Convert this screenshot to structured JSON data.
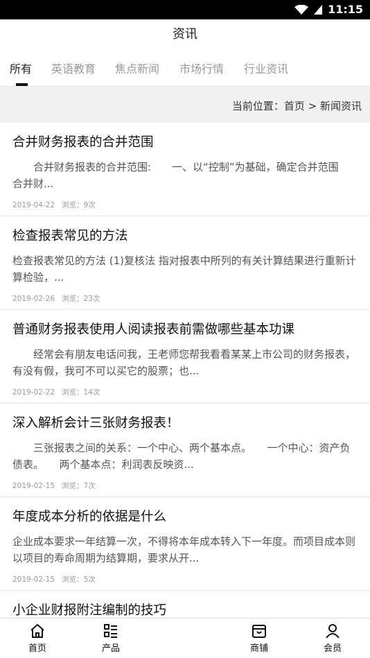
{
  "status": {
    "time": "11:15"
  },
  "header": {
    "title": "资讯"
  },
  "tabs": [
    {
      "label": "所有"
    },
    {
      "label": "英语教育"
    },
    {
      "label": "焦点新闻"
    },
    {
      "label": "市场行情"
    },
    {
      "label": "行业资讯"
    }
  ],
  "breadcrumb": {
    "text": "当前位置：首页 > 新闻资讯"
  },
  "articles": [
    {
      "title": "合并财务报表的合并范围",
      "summary": "　　合并财务报表的合并范围:　　一、以“控制”为基础，确定合并范围　　合并财...",
      "date": "2019-04-22",
      "views": "浏览：9次"
    },
    {
      "title": "检查报表常见的方法",
      "summary": "检查报表常见的方法 (1)复核法 指对报表中所列的有关计算结果进行重新计算检验，...",
      "date": "2019-02-26",
      "views": "浏览：23次"
    },
    {
      "title": "普通财务报表使用人阅读报表前需做哪些基本功课",
      "summary": "　　经常会有朋友电话问我，王老师您帮我看看某某上市公司的财务报表，有没有假，我可不可以买它的股票；也...",
      "date": "2019-02-22",
      "views": "浏览：14次"
    },
    {
      "title": "深入解析会计三张财务报表！",
      "summary": "　　三张报表之间的关系：一个中心、两个基本点。　　一个中心：资产负债表。　　两个基本点：利润表反映资...",
      "date": "2019-02-15",
      "views": "浏览：7次"
    },
    {
      "title": "年度成本分析的依据是什么",
      "summary": "企业成本要求一年结算一次，不得将本年成本转入下一年度。而项目成本则以项目的寿命周期为结算期，要求从开...",
      "date": "2019-02-15",
      "views": "浏览：5次"
    },
    {
      "title": "小企业财报附注编制的技巧",
      "summary": "",
      "date": "",
      "views": ""
    }
  ],
  "bottom_nav": [
    {
      "label": "首页",
      "icon": "home-icon"
    },
    {
      "label": "产品",
      "icon": "list-icon"
    },
    {
      "label": "商铺",
      "icon": "shop-icon"
    },
    {
      "label": "会员",
      "icon": "user-icon"
    }
  ]
}
